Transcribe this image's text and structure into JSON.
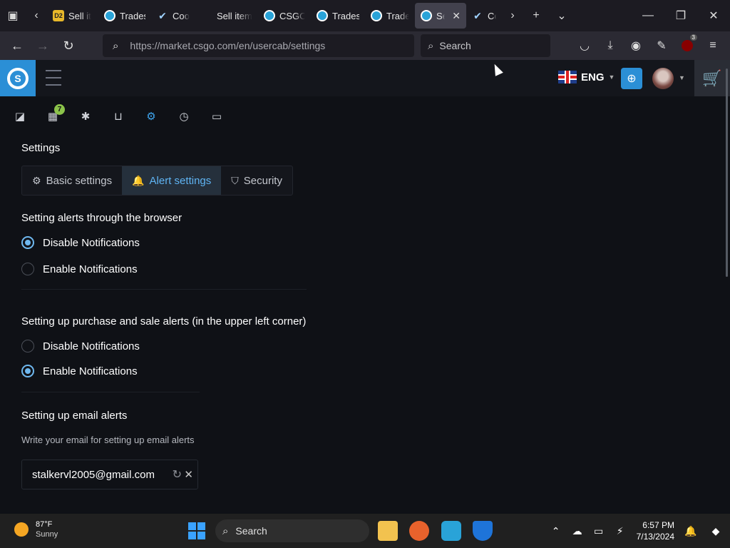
{
  "browser": {
    "tabs": [
      {
        "label": "Sell it",
        "icon": "d2-icon"
      },
      {
        "label": "Trades",
        "icon": "csgo-icon"
      },
      {
        "label": "Coo",
        "icon": "steam-icon"
      },
      {
        "label": "Sell items",
        "icon": ""
      },
      {
        "label": "CSGO",
        "icon": "csgo-icon"
      },
      {
        "label": "Trades",
        "icon": "csgo-icon"
      },
      {
        "label": "Trade",
        "icon": "csgo-icon"
      },
      {
        "label": "Se",
        "icon": "csgo-icon",
        "active": true
      },
      {
        "label": "Co",
        "icon": "steam-icon"
      }
    ],
    "url": "https://market.csgo.com/en/usercab/settings",
    "search_placeholder": "Search",
    "extension_badge": "3"
  },
  "site": {
    "language": "ENG",
    "accent_color": "#2b8fd6",
    "subnav": {
      "badge_count": "7",
      "active": "settings"
    }
  },
  "page": {
    "title": "Settings",
    "tabs": [
      {
        "label": "Basic settings",
        "icon": "gear-icon"
      },
      {
        "label": "Alert settings",
        "icon": "bell-icon",
        "active": true
      },
      {
        "label": "Security",
        "icon": "shield-icon"
      }
    ],
    "browser_alerts": {
      "title": "Setting alerts through the browser",
      "options": [
        "Disable Notifications",
        "Enable Notifications"
      ],
      "selected": "Disable Notifications"
    },
    "trade_alerts": {
      "title": "Setting up purchase and sale alerts (in the upper left corner)",
      "options": [
        "Disable Notifications",
        "Enable Notifications"
      ],
      "selected": "Enable Notifications"
    },
    "email_alerts": {
      "title": "Setting up email alerts",
      "hint": "Write your email for setting up email alerts",
      "email": "stalkervl2005@gmail.com"
    }
  },
  "taskbar": {
    "temperature": "87°F",
    "condition": "Sunny",
    "search_placeholder": "Search",
    "time": "6:57 PM",
    "date": "7/13/2024"
  }
}
